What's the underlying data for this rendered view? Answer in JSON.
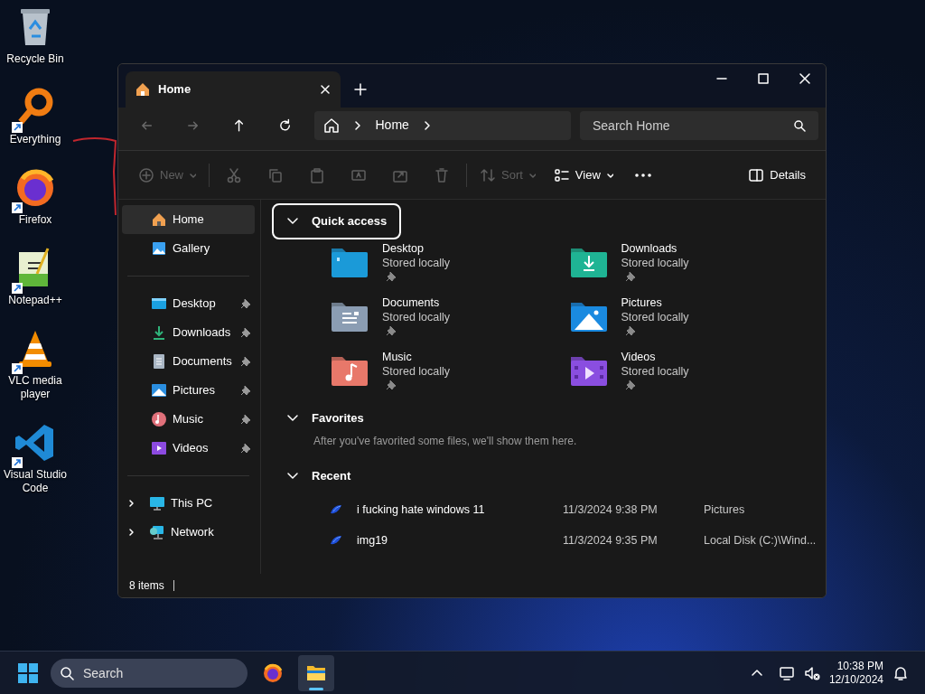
{
  "desktop_icons": [
    {
      "label": "Recycle Bin",
      "kind": "recycle",
      "shortcut": false
    },
    {
      "label": "Everything",
      "kind": "everything",
      "shortcut": true
    },
    {
      "label": "Firefox",
      "kind": "firefox",
      "shortcut": true
    },
    {
      "label": "Notepad++",
      "kind": "notepad",
      "shortcut": true
    },
    {
      "label": "VLC media player",
      "kind": "vlc",
      "shortcut": true
    },
    {
      "label": "Visual Studio Code",
      "kind": "vscode",
      "shortcut": true
    }
  ],
  "window": {
    "tabs": [
      {
        "label": "Home",
        "selected": true
      }
    ],
    "breadcrumb": [
      "Home"
    ],
    "search": {
      "placeholder": "Search Home"
    },
    "toolbar": [
      {
        "kind": "new",
        "label": "New",
        "disabled": true
      },
      {
        "kind": "cut",
        "disabled": true
      },
      {
        "kind": "copy",
        "disabled": true
      },
      {
        "kind": "paste",
        "disabled": true
      },
      {
        "kind": "rename",
        "disabled": true
      },
      {
        "kind": "share",
        "disabled": true
      },
      {
        "kind": "delete",
        "disabled": true
      },
      {
        "kind": "sort",
        "label": "Sort",
        "disabled": true
      },
      {
        "kind": "view",
        "label": "View",
        "disabled": false
      },
      {
        "kind": "more",
        "disabled": false
      },
      {
        "kind": "details",
        "label": "Details",
        "disabled": false
      }
    ],
    "sidebar": [
      [
        {
          "label": "Home",
          "kind": "home",
          "selected": true
        },
        {
          "label": "Gallery",
          "kind": "gallery",
          "selected": false
        }
      ],
      [
        {
          "label": "Desktop",
          "kind": "desktop",
          "selected": false,
          "pinned": true
        },
        {
          "label": "Downloads",
          "kind": "downloads",
          "selected": false,
          "pinned": true
        },
        {
          "label": "Documents",
          "kind": "documents",
          "selected": false,
          "pinned": true
        },
        {
          "label": "Pictures",
          "kind": "pictures",
          "selected": false,
          "pinned": true
        },
        {
          "label": "Music",
          "kind": "music",
          "selected": false,
          "pinned": true
        },
        {
          "label": "Videos",
          "kind": "videos",
          "selected": false,
          "pinned": true
        }
      ],
      [
        {
          "label": "This PC",
          "kind": "pc",
          "selected": false,
          "expanded": false
        },
        {
          "label": "Network",
          "kind": "network",
          "selected": false,
          "expanded": false
        }
      ]
    ],
    "quick_access": {
      "title": "Quick access",
      "expanded": true,
      "folders": [
        {
          "name": "Desktop",
          "status": "Stored locally",
          "kind": "desktop",
          "pinned": true
        },
        {
          "name": "Downloads",
          "status": "Stored locally",
          "kind": "downloads",
          "pinned": true
        },
        {
          "name": "Documents",
          "status": "Stored locally",
          "kind": "documents",
          "pinned": true
        },
        {
          "name": "Pictures",
          "status": "Stored locally",
          "kind": "pictures",
          "pinned": true
        },
        {
          "name": "Music",
          "status": "Stored locally",
          "kind": "music",
          "pinned": true
        },
        {
          "name": "Videos",
          "status": "Stored locally",
          "kind": "videos",
          "pinned": true
        }
      ]
    },
    "favorites": {
      "title": "Favorites",
      "expanded": true,
      "message": "After you've favorited some files, we'll show them here."
    },
    "recent": {
      "title": "Recent",
      "expanded": true,
      "rows": [
        {
          "name": "i fucking hate windows 11",
          "date": "11/3/2024 9:38 PM",
          "location": "Pictures"
        },
        {
          "name": "img19",
          "date": "11/3/2024 9:35 PM",
          "location": "Local Disk (C:)\\Wind..."
        }
      ]
    },
    "status_bar": "8 items"
  },
  "taskbar": {
    "search": {
      "placeholder": "Search"
    },
    "apps": [
      {
        "kind": "firefox",
        "active": false
      },
      {
        "kind": "explorer",
        "active": true
      }
    ],
    "time": "10:38 PM",
    "date": "12/10/2024"
  }
}
